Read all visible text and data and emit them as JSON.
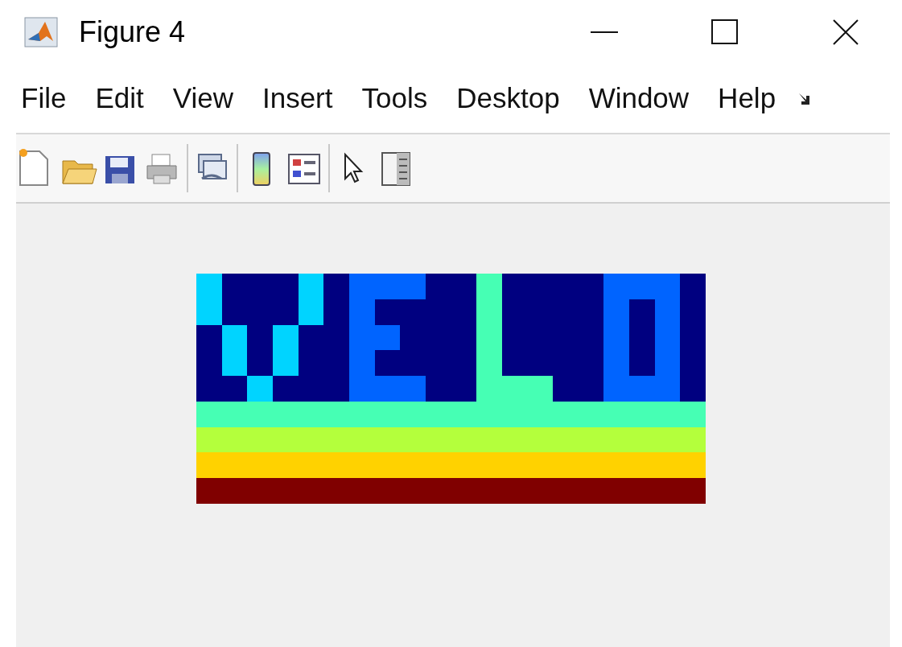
{
  "window": {
    "title": "Figure 4"
  },
  "menu": [
    "File",
    "Edit",
    "View",
    "Insert",
    "Tools",
    "Desktop",
    "Window",
    "Help"
  ]
}
